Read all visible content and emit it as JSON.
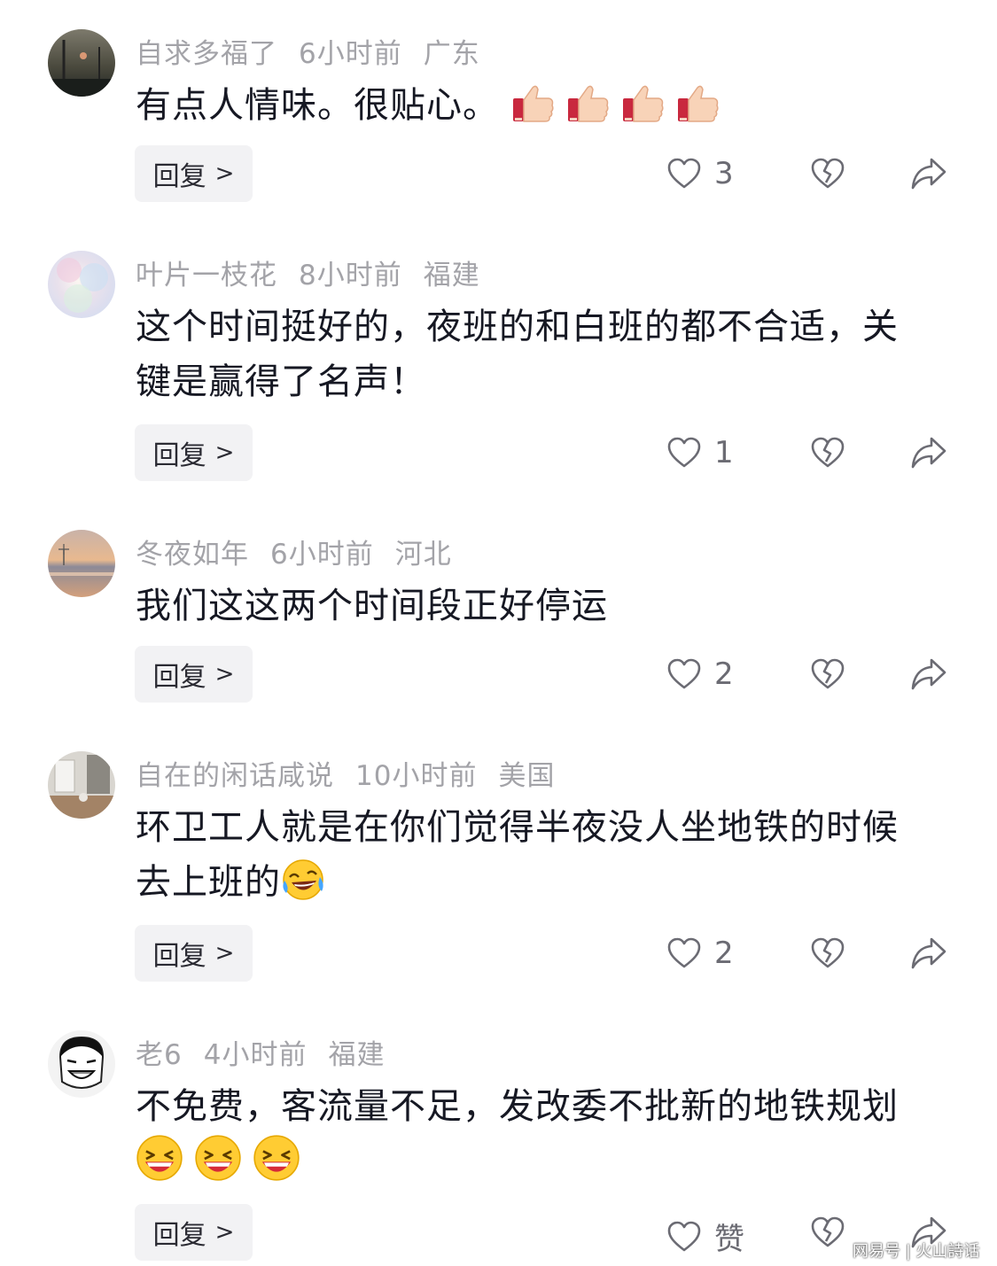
{
  "comments": [
    {
      "username": "自求多福了",
      "time": "6小时前",
      "location": "广东",
      "text": "有点人情味。很贴心。",
      "emojis": [
        "thumbs-up",
        "thumbs-up",
        "thumbs-up",
        "thumbs-up"
      ],
      "reply_label": "回复",
      "likes": "3"
    },
    {
      "username": "叶片一枝花",
      "time": "8小时前",
      "location": "福建",
      "text_line1": "这个时间挺好的，夜班的和白班的都不合适，关",
      "text_line2": "键是赢得了名声！",
      "reply_label": "回复",
      "likes": "1"
    },
    {
      "username": "冬夜如年",
      "time": "6小时前",
      "location": "河北",
      "text": "我们这这两个时间段正好停运",
      "reply_label": "回复",
      "likes": "2"
    },
    {
      "username": "自在的闲话咸说",
      "time": "10小时前",
      "location": "美国",
      "text_line1": "环卫工人就是在你们觉得半夜没人坐地铁的时候",
      "text_line2": "去上班的",
      "emojis": [
        "laughing-crying"
      ],
      "reply_label": "回复",
      "likes": "2"
    },
    {
      "username": "老6",
      "time": "4小时前",
      "location": "福建",
      "text_line1": "不免费，客流量不足，发改委不批新的地铁规划",
      "emojis": [
        "grinning",
        "grinning",
        "grinning"
      ],
      "reply_label": "回复",
      "likes": "赞"
    }
  ],
  "watermark": "网易号 | 火山詩话",
  "colors": {
    "meta": "#a3a3a8",
    "text": "#161823",
    "reply_bg": "#f2f2f4",
    "icon": "#6b6b73"
  }
}
